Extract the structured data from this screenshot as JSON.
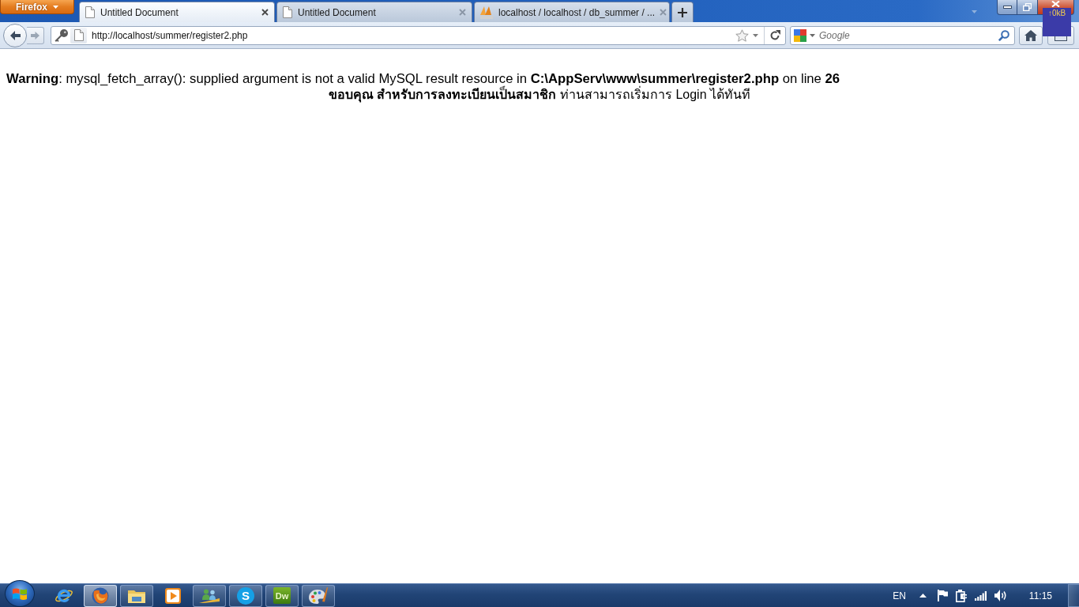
{
  "browser": {
    "app_menu": "Firefox",
    "tabs": [
      {
        "kind": "page",
        "title": "Untitled Document",
        "selected": true
      },
      {
        "kind": "page",
        "title": "Untitled Document",
        "selected": false
      },
      {
        "kind": "pma",
        "title": "localhost / localhost / db_summer / ...",
        "selected": false
      }
    ],
    "address": "http://localhost/summer/register2.php",
    "search": {
      "placeholder": "Google"
    }
  },
  "net_meter": {
    "reading": "↑0kB"
  },
  "page": {
    "warning": "**Warning**: mysql_fetch_array(): supplied argument is not a valid MySQL result resource in **C:\\AppServ\\www\\summer\\register2.php** on line **26**",
    "message": "**ขอบคุณ สำหรับการลงทะเบียนเป็นสมาชิก** ท่านสามารถเริ่มการ Login ได้ทันที"
  },
  "taskbar": {
    "apps": [
      {
        "kind": "ie",
        "running": false,
        "selected": false
      },
      {
        "kind": "firefox",
        "running": true,
        "selected": true
      },
      {
        "kind": "explorer",
        "running": true,
        "selected": false
      },
      {
        "kind": "media",
        "running": false,
        "selected": false
      },
      {
        "kind": "people",
        "running": true,
        "selected": false
      },
      {
        "kind": "skype",
        "label": "S",
        "running": true,
        "selected": false
      },
      {
        "kind": "dreamweaver",
        "label": "Dw",
        "running": true,
        "selected": false
      },
      {
        "kind": "paint",
        "running": true,
        "selected": false
      }
    ],
    "tray": {
      "language": "EN",
      "clock": "11:15"
    }
  }
}
